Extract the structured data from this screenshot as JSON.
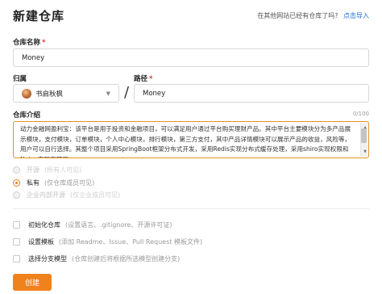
{
  "page": {
    "title": "新建仓库",
    "import_question": "在其他网站已经有仓库了吗?",
    "import_link": "点击导入",
    "create_button": "创建"
  },
  "repo_name": {
    "label": "仓库名称",
    "required_mark": "*",
    "value": "Money"
  },
  "owner": {
    "label": "归属",
    "value": "书启秋枫",
    "separator": "/"
  },
  "path": {
    "label": "路径",
    "required_mark": "*",
    "value": "Money"
  },
  "description": {
    "label": "仓库介绍",
    "counter": "0/100",
    "value": "动力金融网盈利宝：该平台是用于投资和金融项目，可以满足用户通过平台购买理财产品。其中平台主要模块分为多产品展示模块，支付模块，订单模块，个人中心模块，排行模块，第三方支付，其中产品详情模块可以展示产品的收益，风险等，用户可以自行选择。其整个项目采用SpringBoot框架分布式开发，采用Redis实现分布式缓存处理，采用shiro实现权限和Nginx实现高可用。"
  },
  "visibility": [
    {
      "label": "开源",
      "hint": "(所有人可见)",
      "state": "disabled"
    },
    {
      "label": "私有",
      "hint": "(仅仓库成员可见)",
      "state": "selected"
    },
    {
      "label": "企业内部开源",
      "hint": "(仅企业成员可见)",
      "state": "disabled"
    }
  ],
  "options": [
    {
      "label": "初始化仓库",
      "hint": "(设置语言、.gitignore、开源许可证)"
    },
    {
      "label": "设置模板",
      "hint": "(添加 Readme、Issue、Pull Request 模板文件)"
    },
    {
      "label": "选择分支模型",
      "hint": "(仓库创建后将根据所选模型创建分支)"
    }
  ],
  "colors": {
    "accent": "#f0821d",
    "link": "#1e6fd9",
    "required": "#e0342b"
  }
}
